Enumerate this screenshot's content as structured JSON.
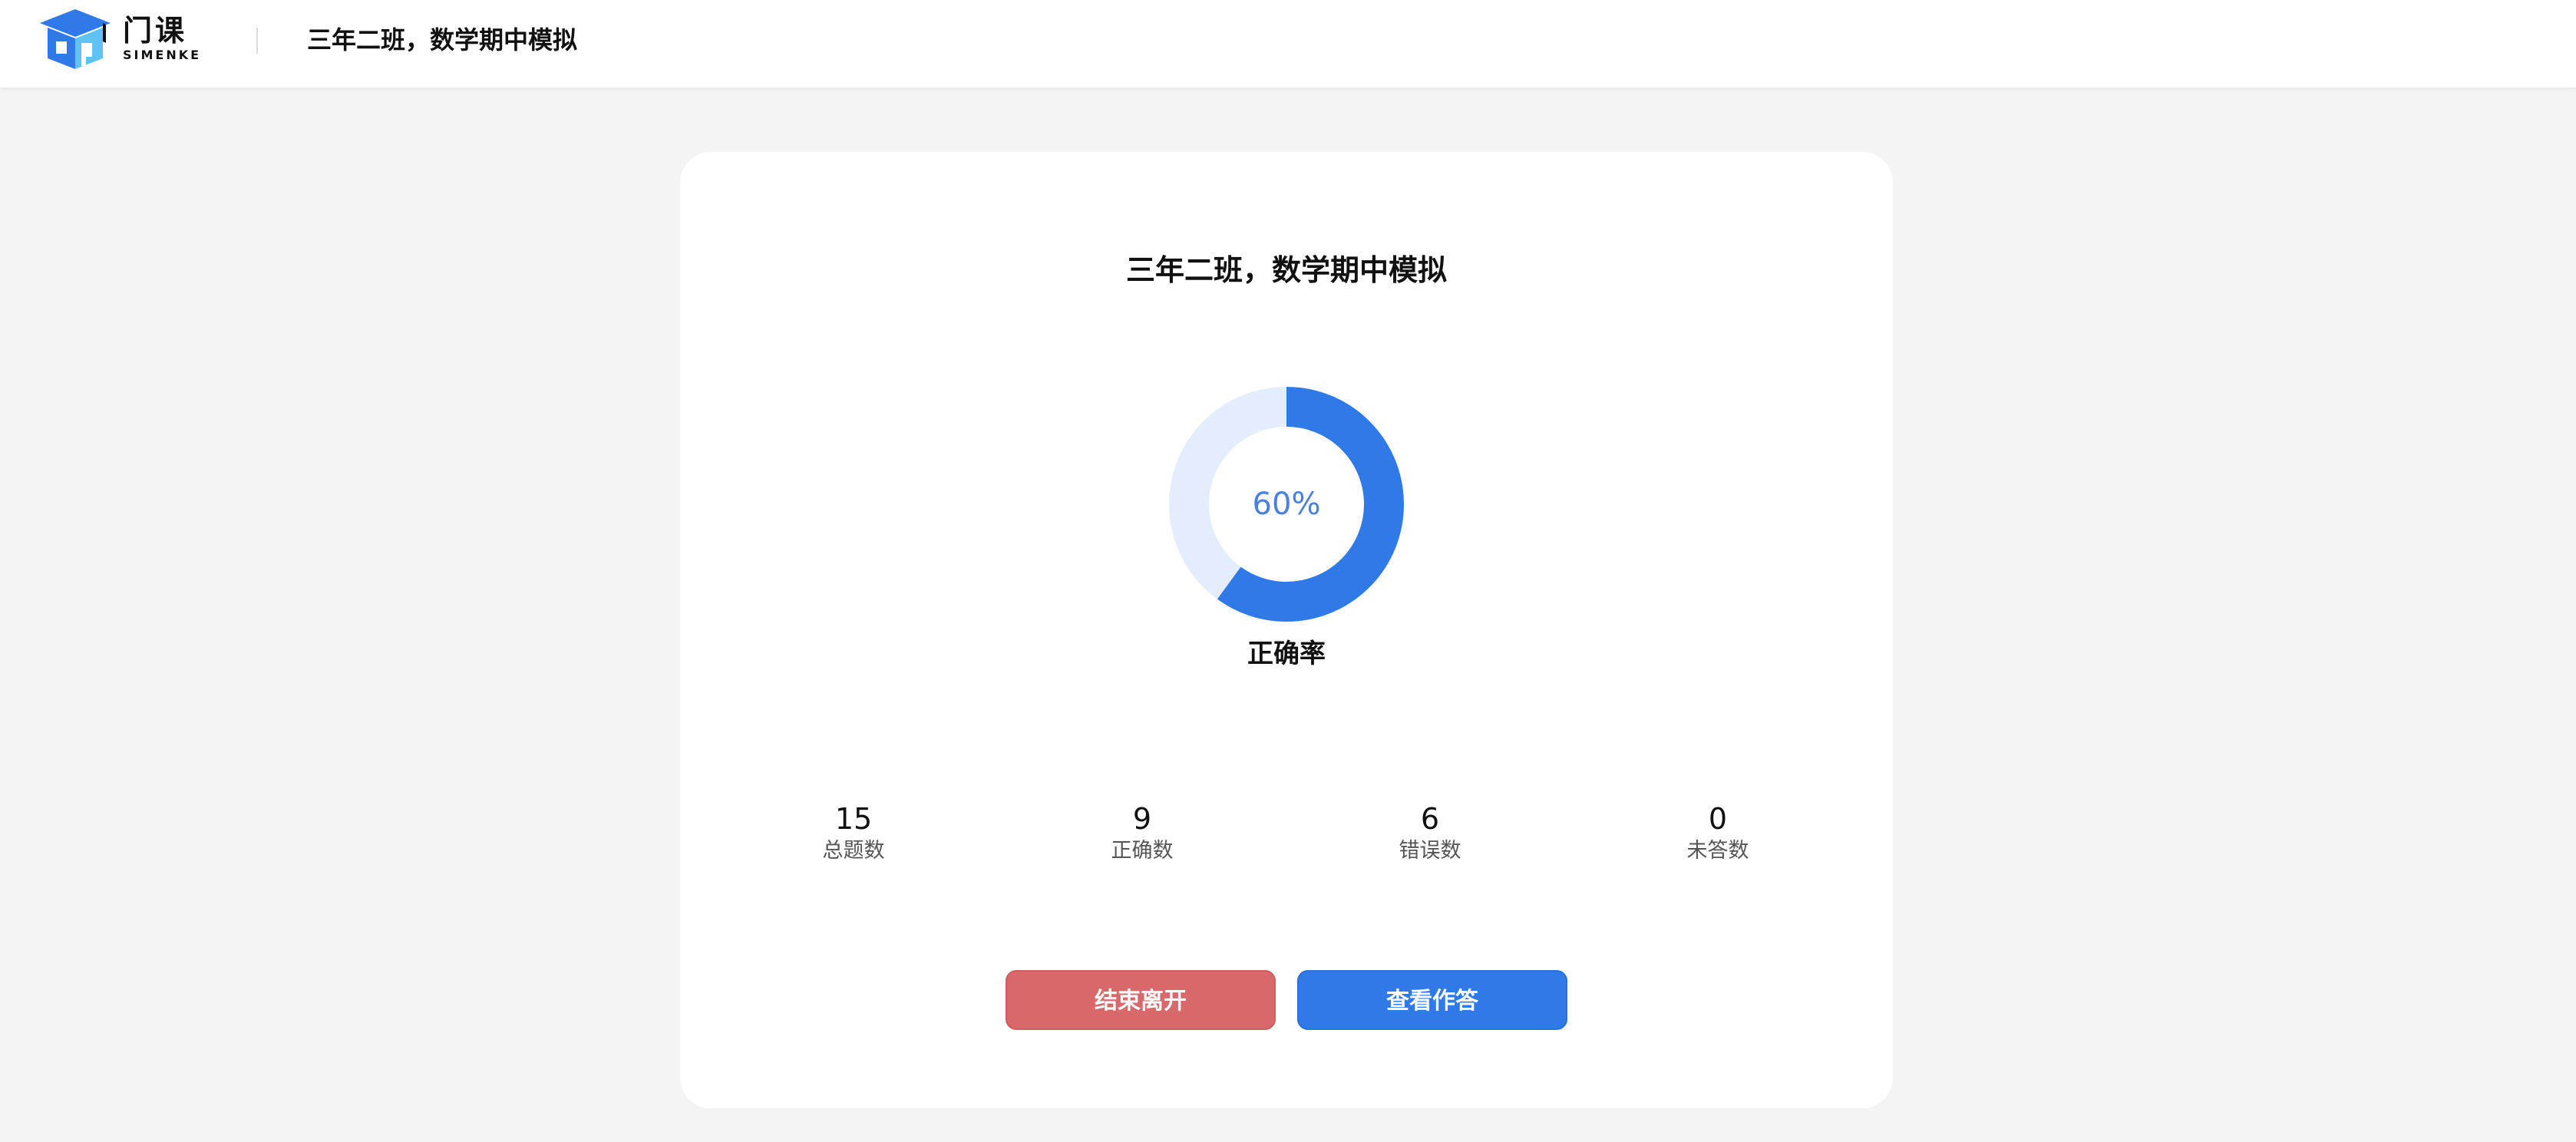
{
  "header": {
    "brand_name": "门课",
    "brand_sub": "SIMENKE",
    "title": "三年二班，数学期中模拟"
  },
  "result": {
    "title": "三年二班，数学期中模拟",
    "accuracy_text": "60%",
    "accuracy_value": 60,
    "accuracy_label": "正确率",
    "stats": [
      {
        "value": "15",
        "label": "总题数"
      },
      {
        "value": "9",
        "label": "正确数"
      },
      {
        "value": "6",
        "label": "错误数"
      },
      {
        "value": "0",
        "label": "未答数"
      }
    ],
    "buttons": {
      "leave": "结束离开",
      "review": "查看作答"
    }
  },
  "colors": {
    "accent": "#2f7ae8",
    "donut_fill": "#2f7ae8",
    "donut_track": "#e4edfb",
    "percent_text": "#4a80e6",
    "leave_button": "#d8686a",
    "background": "#f4f4f4"
  },
  "icons": {
    "logo": "graduation-cap-logo-icon"
  }
}
